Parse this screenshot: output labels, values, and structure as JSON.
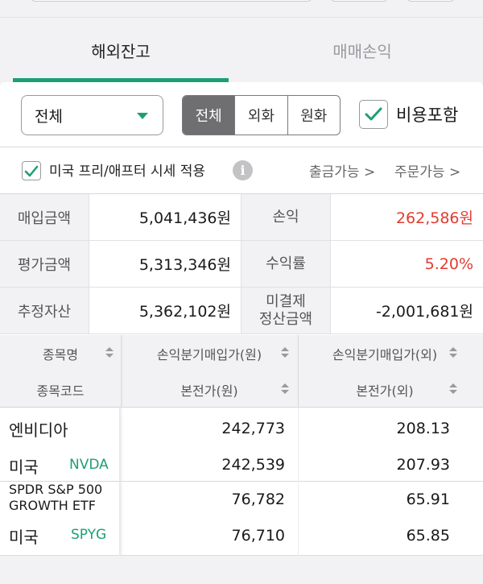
{
  "tabs": {
    "active": "해외잔고",
    "inactive": "매매손익"
  },
  "filter": {
    "select_value": "전체",
    "segments": [
      "전체",
      "외화",
      "원화"
    ],
    "selected_segment": "전체",
    "include_cost_label": "비용포함",
    "include_cost_checked": true
  },
  "pre_after": {
    "label": "미국 프리/애프터 시세 적용",
    "checked": true,
    "link_withdraw": "출금가능 >",
    "link_order": "주문가능 >"
  },
  "summary": {
    "purchase_label": "매입금액",
    "purchase_value": "5,041,436원",
    "pnl_label": "손익",
    "pnl_value": "262,586원",
    "eval_label": "평가금액",
    "eval_value": "5,313,346원",
    "return_label": "수익률",
    "return_value": "5.20%",
    "est_asset_label": "추정자산",
    "est_asset_value": "5,362,102원",
    "unsettled_label_1": "미결제",
    "unsettled_label_2": "정산금액",
    "unsettled_value": "-2,001,681원"
  },
  "holdings_header": {
    "col1_top": "종목명",
    "col1_bottom": "종목코드",
    "col2_top": "손익분기매입가(원)",
    "col2_bottom": "본전가(원)",
    "col3_top": "손익분기매입가(외)",
    "col3_bottom": "본전가(외)"
  },
  "holdings": [
    {
      "name": "엔비디아",
      "country": "미국",
      "code": "NVDA",
      "breakeven_krw": "242,773",
      "breakeven_fx": "208.13",
      "principal_krw": "242,539",
      "principal_fx": "207.93"
    },
    {
      "name_line1": "SPDR S&P 500",
      "name_line2": "GROWTH ETF",
      "country": "미국",
      "code": "SPYG",
      "breakeven_krw": "76,782",
      "breakeven_fx": "65.91",
      "principal_krw": "76,710",
      "principal_fx": "65.85"
    }
  ],
  "colors": {
    "accent_green": "#1e9e76",
    "loss_red": "#e23b2f"
  }
}
